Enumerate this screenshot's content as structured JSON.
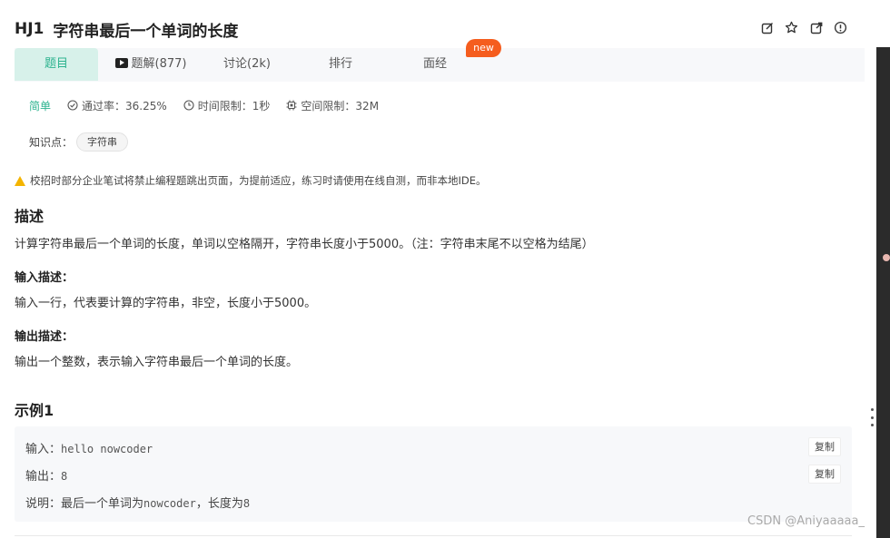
{
  "header": {
    "problem_id": "HJ1",
    "problem_title": "字符串最后一个单词的长度",
    "icons": [
      "edit-icon",
      "star-icon",
      "share-icon",
      "info-icon"
    ]
  },
  "tabs": [
    {
      "label": "题目",
      "active": true
    },
    {
      "label": "题解(877)",
      "icon": "video-play-icon"
    },
    {
      "label": "讨论(2k)"
    },
    {
      "label": "排行"
    },
    {
      "label": "面经",
      "badge": "new"
    }
  ],
  "meta": {
    "difficulty": "简单",
    "pass_rate": "通过率：36.25%",
    "time_limit": "时间限制：1秒",
    "memory_limit": "空间限制：32M"
  },
  "knowledge": {
    "label": "知识点：",
    "tag": "字符串"
  },
  "notice": "校招时部分企业笔试将禁止编程题跳出页面，为提前适应，练习时请使用在线自测，而非本地IDE。",
  "description": {
    "heading": "描述",
    "text": "计算字符串最后一个单词的长度，单词以空格隔开，字符串长度小于5000。（注：字符串末尾不以空格为结尾）"
  },
  "input_desc": {
    "heading": "输入描述：",
    "text": "输入一行，代表要计算的字符串，非空，长度小于5000。"
  },
  "output_desc": {
    "heading": "输出描述：",
    "text": "输出一个整数，表示输入字符串最后一个单词的长度。"
  },
  "example": {
    "heading": "示例1",
    "input_label": "输入：",
    "input_value": "hello nowcoder",
    "output_label": "输出：",
    "output_value": "8",
    "explain_label": "说明：",
    "explain_prefix": "最后一个单词为",
    "explain_code": "nowcoder",
    "explain_mid": "，长度为",
    "explain_num": "8",
    "copy_label": "复制"
  },
  "watermark": "CSDN @Aniyaaaaa_",
  "colors": {
    "accent": "#2db38f",
    "tab_active_bg": "#d7f1ea",
    "badge": "#f55d1e",
    "warn": "#f4b400"
  }
}
